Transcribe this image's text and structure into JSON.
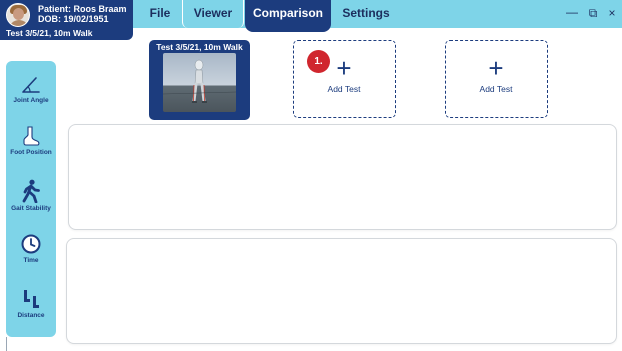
{
  "patient": {
    "name": "Patient: Roos Braam",
    "dob": "DOB: 19/02/1951",
    "current_test": "Test 3/5/21, 10m Walk"
  },
  "menu": {
    "tabs": [
      {
        "label": "File",
        "active": false
      },
      {
        "label": "Viewer",
        "active": false
      },
      {
        "label": "Comparison",
        "active": true
      },
      {
        "label": "Settings",
        "active": false
      }
    ]
  },
  "window_controls": {
    "minimize": "—",
    "restore": "⧉",
    "close": "×"
  },
  "sidebar": {
    "items": [
      {
        "label": "Joint Angle",
        "icon": "joint-angle-icon"
      },
      {
        "label": "Foot Position",
        "icon": "foot-icon"
      },
      {
        "label": "Gait Stability",
        "icon": "walking-person-icon"
      },
      {
        "label": "Time",
        "icon": "clock-icon"
      },
      {
        "label": "Distance",
        "icon": "footprints-icon"
      }
    ]
  },
  "comparison": {
    "test_card": {
      "title": "Test 3/5/21, 10m Walk"
    },
    "add_slots": [
      {
        "plus": "+",
        "label": "Add Test"
      },
      {
        "plus": "+",
        "label": "Add Test"
      }
    ],
    "step_badge": "1."
  },
  "colors": {
    "accent": "#7ed4e8",
    "navy": "#1c3c7e",
    "badge": "#d0262e"
  }
}
